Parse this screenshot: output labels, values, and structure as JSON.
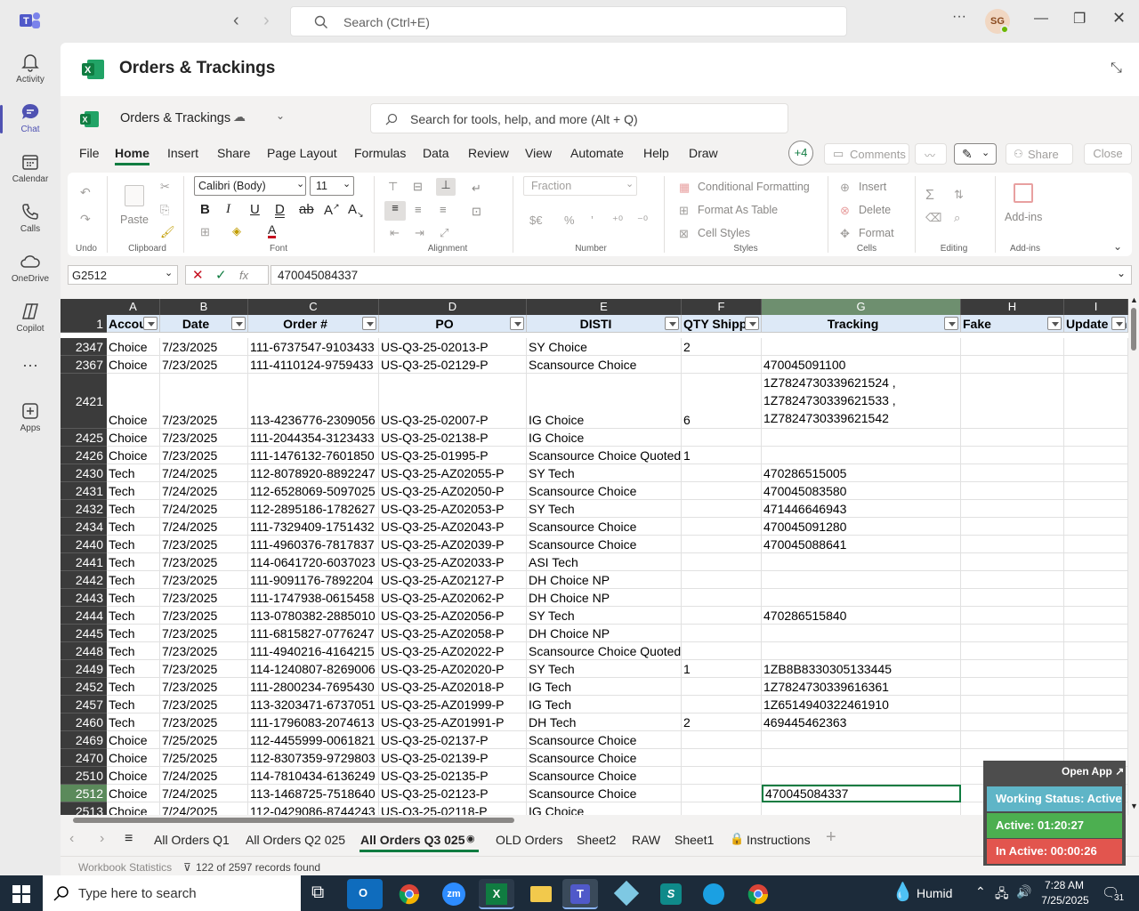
{
  "topbar": {
    "search_placeholder": "Search (Ctrl+E)",
    "avatar_initials": "SG"
  },
  "rail": {
    "items": [
      {
        "label": "Activity",
        "icon": "bell-icon"
      },
      {
        "label": "Chat",
        "icon": "chat-icon"
      },
      {
        "label": "Calendar",
        "icon": "calendar-icon"
      },
      {
        "label": "Calls",
        "icon": "phone-icon"
      },
      {
        "label": "OneDrive",
        "icon": "cloud-icon"
      },
      {
        "label": "Copilot",
        "icon": "copilot-icon"
      },
      {
        "label": "Apps",
        "icon": "add-app-icon"
      }
    ],
    "active": "Chat"
  },
  "app": {
    "title": "Orders & Trackings",
    "workbook_name": "Orders & Trackings",
    "search_placeholder": "Search for tools, help, and more (Alt + Q)"
  },
  "menu": {
    "tabs": [
      "File",
      "Home",
      "Insert",
      "Share",
      "Page Layout",
      "Formulas",
      "Data",
      "Review",
      "View",
      "Automate",
      "Help",
      "Draw"
    ],
    "active": "Home",
    "more_count": "+4",
    "comments_label": "Comments",
    "share_label": "Share",
    "close_label": "Close"
  },
  "ribbon": {
    "font_name": "Calibri (Body)",
    "font_size": "11",
    "number_format": "Fraction",
    "paste_label": "Paste",
    "conditional_formatting": "Conditional Formatting",
    "format_as_table": "Format As Table",
    "cell_styles": "Cell Styles",
    "insert": "Insert",
    "delete": "Delete",
    "format": "Format",
    "addins": "Add-ins",
    "groups": {
      "undo": "Undo",
      "clipboard": "Clipboard",
      "font": "Font",
      "alignment": "Alignment",
      "number": "Number",
      "styles": "Styles",
      "cells": "Cells",
      "editing": "Editing",
      "addins": "Add-ins"
    }
  },
  "formula_bar": {
    "name_box": "G2512",
    "fx": "fx",
    "value": "470045084337"
  },
  "sheet": {
    "columns": [
      "A",
      "B",
      "C",
      "D",
      "E",
      "F",
      "G",
      "H",
      "I"
    ],
    "header_row_number": "1",
    "headers": [
      "Accou",
      "Date",
      "Order #",
      "PO",
      "DISTI",
      "QTY Shippe",
      "Tracking",
      "Fake",
      "Update on"
    ],
    "rows": [
      {
        "n": "2347",
        "a": "Choice",
        "b": "7/23/2025",
        "c": "111-6737547-9103433",
        "d": "US-Q3-25-02013-P",
        "e": "SY Choice",
        "f": "2",
        "g": ""
      },
      {
        "n": "2367",
        "a": "Choice",
        "b": "7/23/2025",
        "c": "111-4110124-9759433",
        "d": "US-Q3-25-02129-P",
        "e": "Scansource Choice",
        "f": "",
        "g": "470045091100"
      },
      {
        "n": "2421",
        "a": "Choice",
        "b": "7/23/2025",
        "c": "113-4236776-2309056",
        "d": "US-Q3-25-02007-P",
        "e": "IG Choice",
        "f": "6",
        "g": "",
        "g_lines": [
          "1Z7824730339621524 ,",
          "1Z7824730339621533 ,",
          "1Z7824730339621542"
        ]
      },
      {
        "n": "2425",
        "a": "Choice",
        "b": "7/23/2025",
        "c": "111-2044354-3123433",
        "d": "US-Q3-25-02138-P",
        "e": "IG Choice",
        "f": "",
        "g": ""
      },
      {
        "n": "2426",
        "a": "Choice",
        "b": "7/23/2025",
        "c": "111-1476132-7601850",
        "d": "US-Q3-25-01995-P",
        "e": "Scansource Choice Quoted",
        "f": "1",
        "g": ""
      },
      {
        "n": "2430",
        "a": "Tech",
        "b": "7/24/2025",
        "c": "112-8078920-8892247",
        "d": "US-Q3-25-AZ02055-P",
        "e": "SY Tech",
        "f": "",
        "g": "470286515005"
      },
      {
        "n": "2431",
        "a": "Tech",
        "b": "7/24/2025",
        "c": "112-6528069-5097025",
        "d": "US-Q3-25-AZ02050-P",
        "e": "Scansource Choice",
        "f": "",
        "g": "470045083580"
      },
      {
        "n": "2432",
        "a": "Tech",
        "b": "7/24/2025",
        "c": "112-2895186-1782627",
        "d": "US-Q3-25-AZ02053-P",
        "e": "SY Tech",
        "f": "",
        "g": "471446646943"
      },
      {
        "n": "2434",
        "a": "Tech",
        "b": "7/24/2025",
        "c": "111-7329409-1751432",
        "d": "US-Q3-25-AZ02043-P",
        "e": "Scansource Choice",
        "f": "",
        "g": "470045091280"
      },
      {
        "n": "2440",
        "a": "Tech",
        "b": "7/23/2025",
        "c": "111-4960376-7817837",
        "d": "US-Q3-25-AZ02039-P",
        "e": "Scansource Choice",
        "f": "",
        "g": "470045088641"
      },
      {
        "n": "2441",
        "a": "Tech",
        "b": "7/23/2025",
        "c": "114-0641720-6037023",
        "d": "US-Q3-25-AZ02033-P",
        "e": "ASI Tech",
        "f": "",
        "g": ""
      },
      {
        "n": "2442",
        "a": "Tech",
        "b": "7/23/2025",
        "c": "111-9091176-7892204",
        "d": "US-Q3-25-AZ02127-P",
        "e": "DH Choice NP",
        "f": "",
        "g": ""
      },
      {
        "n": "2443",
        "a": "Tech",
        "b": "7/23/2025",
        "c": "111-1747938-0615458",
        "d": "US-Q3-25-AZ02062-P",
        "e": "DH Choice NP",
        "f": "",
        "g": ""
      },
      {
        "n": "2444",
        "a": "Tech",
        "b": "7/23/2025",
        "c": "113-0780382-2885010",
        "d": "US-Q3-25-AZ02056-P",
        "e": "SY Tech",
        "f": "",
        "g": "470286515840"
      },
      {
        "n": "2445",
        "a": "Tech",
        "b": "7/23/2025",
        "c": "111-6815827-0776247",
        "d": "US-Q3-25-AZ02058-P",
        "e": "DH Choice NP",
        "f": "",
        "g": ""
      },
      {
        "n": "2448",
        "a": "Tech",
        "b": "7/23/2025",
        "c": "111-4940216-4164215",
        "d": "US-Q3-25-AZ02022-P",
        "e": "Scansource Choice Quoted",
        "f": "",
        "g": ""
      },
      {
        "n": "2449",
        "a": "Tech",
        "b": "7/23/2025",
        "c": "114-1240807-8269006",
        "d": "US-Q3-25-AZ02020-P",
        "e": "SY Tech",
        "f": "1",
        "g": "1ZB8B8330305133445"
      },
      {
        "n": "2452",
        "a": "Tech",
        "b": "7/23/2025",
        "c": "111-2800234-7695430",
        "d": "US-Q3-25-AZ02018-P",
        "e": "IG Tech",
        "f": "",
        "g": "1Z7824730339616361"
      },
      {
        "n": "2457",
        "a": "Tech",
        "b": "7/23/2025",
        "c": "113-3203471-6737051",
        "d": "US-Q3-25-AZ01999-P",
        "e": "IG Tech",
        "f": "",
        "g": "1Z6514940322461910"
      },
      {
        "n": "2460",
        "a": "Tech",
        "b": "7/23/2025",
        "c": "111-1796083-2074613",
        "d": "US-Q3-25-AZ01991-P",
        "e": "DH Tech",
        "f": "2",
        "g": "469445462363"
      },
      {
        "n": "2469",
        "a": "Choice",
        "b": "7/25/2025",
        "c": "112-4455999-0061821",
        "d": "US-Q3-25-02137-P",
        "e": "Scansource Choice",
        "f": "",
        "g": ""
      },
      {
        "n": "2470",
        "a": "Choice",
        "b": "7/25/2025",
        "c": "112-8307359-9729803",
        "d": "US-Q3-25-02139-P",
        "e": "Scansource Choice",
        "f": "",
        "g": ""
      },
      {
        "n": "2510",
        "a": "Choice",
        "b": "7/24/2025",
        "c": "114-7810434-6136249",
        "d": "US-Q3-25-02135-P",
        "e": "Scansource Choice",
        "f": "",
        "g": ""
      },
      {
        "n": "2512",
        "a": "Choice",
        "b": "7/24/2025",
        "c": "113-1468725-7518640",
        "d": "US-Q3-25-02123-P",
        "e": "Scansource Choice",
        "f": "",
        "g": "470045084337"
      },
      {
        "n": "2513",
        "a": "Choice",
        "b": "7/24/2025",
        "c": "112-0429086-8744243",
        "d": "US-Q3-25-02118-P",
        "e": "IG Choice",
        "f": "",
        "g": ""
      }
    ]
  },
  "sheet_tabs": {
    "tabs": [
      "All Orders Q1",
      "All Orders Q2 025",
      "All Orders Q3 025",
      "OLD Orders",
      "Sheet2",
      "RAW",
      "Sheet1",
      "Instructions"
    ],
    "active": "All Orders Q3 025"
  },
  "statusbar": {
    "workbook_statistics": "Workbook Statistics",
    "records": "122 of 2597 records found"
  },
  "status_widget": {
    "open_app": "Open App",
    "working_status": "Working Status: Active",
    "active_time": "Active: 01:20:27",
    "inactive_time": "In Active: 00:00:26",
    "colors": {
      "working": "#5fb5c7",
      "active": "#4caf50",
      "inactive": "#e2554e"
    }
  },
  "taskbar": {
    "search_placeholder": "Type here to search",
    "weather": "Humid",
    "time": "7:28 AM",
    "date": "7/25/2025",
    "notifications": "31"
  }
}
